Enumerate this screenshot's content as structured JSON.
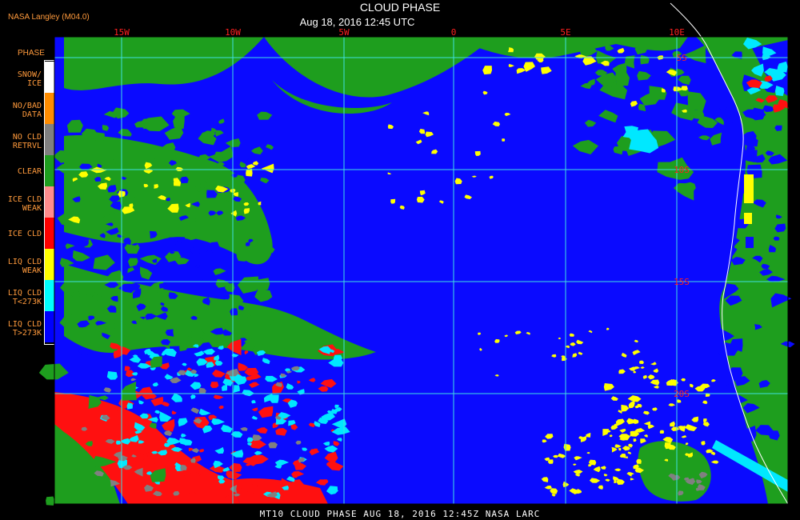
{
  "header": {
    "title": "CLOUD PHASE",
    "subtitle": "Aug 18, 2016 12:45 UTC",
    "source": "NASA Langley (M04.0)"
  },
  "legend": {
    "title": "PHASE",
    "items": [
      {
        "label_line1": "SNOW/",
        "label_line2": "ICE",
        "color": "#ffffff"
      },
      {
        "label_line1": "NO/BAD",
        "label_line2": "DATA",
        "color": "#ff8c00"
      },
      {
        "label_line1": "NO CLD",
        "label_line2": "RETRVL",
        "color": "#808080"
      },
      {
        "label_line1": "CLEAR",
        "label_line2": "",
        "color": "#1e9e1e"
      },
      {
        "label_line1": "ICE CLD",
        "label_line2": "WEAK",
        "color": "#ff8c8c"
      },
      {
        "label_line1": "ICE CLD",
        "label_line2": "",
        "color": "#ff0000"
      },
      {
        "label_line1": "LIQ CLD",
        "label_line2": "WEAK",
        "color": "#ffff00"
      },
      {
        "label_line1": "LIQ CLD",
        "label_line2": "T<273K",
        "color": "#00ffff"
      },
      {
        "label_line1": "LIQ CLD",
        "label_line2": "T>273K",
        "color": "#0000ff"
      }
    ]
  },
  "map": {
    "lon_labels": [
      "15W",
      "10W",
      "5W",
      "0",
      "5E",
      "10E"
    ],
    "lat_labels": [
      "5S",
      "10S",
      "15S",
      "20S"
    ],
    "colors": {
      "ocean_cloud": "#0a0aff",
      "clear": "#1e9e1e",
      "ice": "#ff1010",
      "liq_cold": "#00e8ff",
      "liq_weak": "#ffff00",
      "no_retrieval": "#808080",
      "grid": "#40e0e0",
      "grid_label": "#ff2020",
      "coast": "#ffffff"
    }
  },
  "footer": {
    "text": "MT10  CLOUD PHASE  AUG 18, 2016 12:45Z  NASA LARC"
  }
}
